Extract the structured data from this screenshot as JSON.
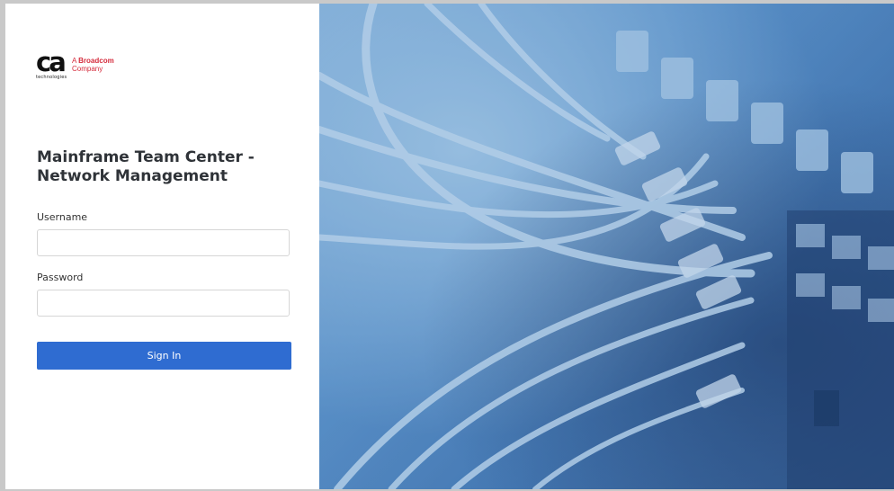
{
  "brand": {
    "logo_mark": "ca",
    "logo_sub": "technologies",
    "tagline_prefix": "A",
    "tagline_bold": "Broadcom",
    "tagline_line2": "Company",
    "accent_color": "#d52b3c"
  },
  "login": {
    "title": "Mainframe Team Center - Network Management",
    "username_label": "Username",
    "username_value": "",
    "password_label": "Password",
    "password_value": "",
    "submit_label": "Sign In",
    "button_color": "#2f6cd1"
  },
  "hero": {
    "description_icon": "network-cables-image"
  }
}
